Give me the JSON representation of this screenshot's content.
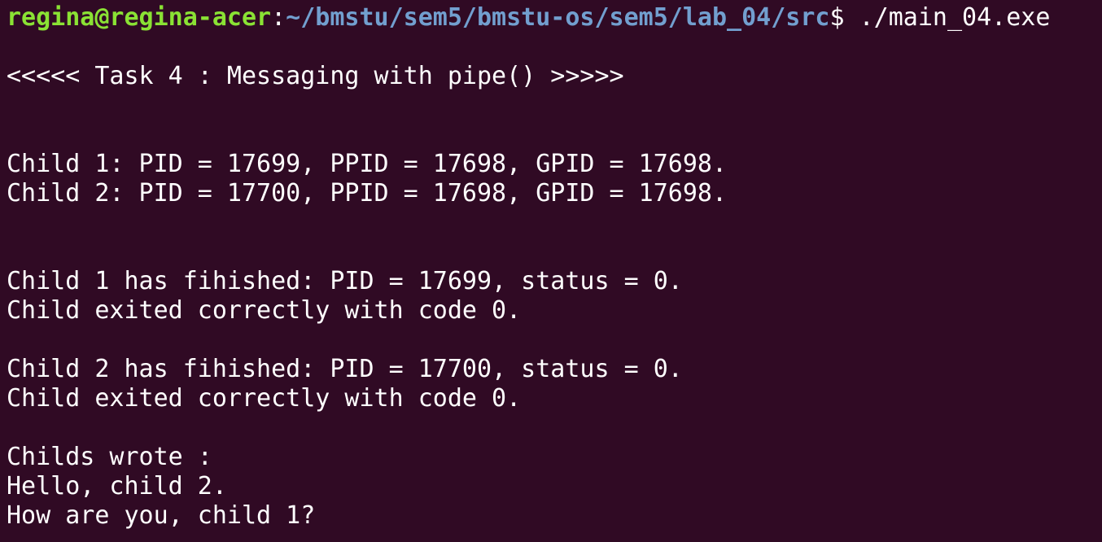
{
  "colors": {
    "background": "#300a24",
    "text": "#ffffff",
    "prompt_user": "#8ae234",
    "prompt_path": "#729fcf"
  },
  "prompt": {
    "user_host": "regina@regina-acer",
    "separator": ":",
    "path": "~/bmstu/sem5/bmstu-os/sem5/lab_04/src",
    "dollar": "$",
    "command": " ./main_04.exe"
  },
  "output": {
    "lines": [
      "",
      "<<<<< Task 4 : Messaging with pipe() >>>>>",
      "",
      "",
      "Child 1: PID = 17699, PPID = 17698, GPID = 17698.",
      "Child 2: PID = 17700, PPID = 17698, GPID = 17698.",
      "",
      "",
      "Child 1 has fihished: PID = 17699, status = 0.",
      "Child exited correctly with code 0.",
      "",
      "Child 2 has fihished: PID = 17700, status = 0.",
      "Child exited correctly with code 0.",
      "",
      "Childs wrote :",
      "Hello, child 2.",
      "How are you, child 1?"
    ]
  }
}
